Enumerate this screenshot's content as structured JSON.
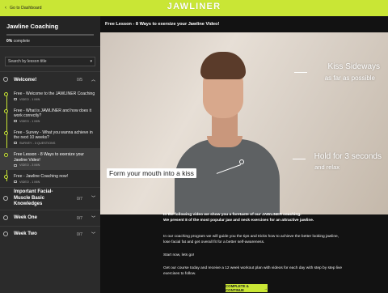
{
  "topbar": {
    "back_label": "Go to Dashboard",
    "logo_text": "JAWLINER"
  },
  "sidebar": {
    "course_title": "Jawline Coaching",
    "progress_percent": 0,
    "progress_value": "0%",
    "progress_text": "complete",
    "search_placeholder": "Search by lesson title",
    "sections": [
      {
        "title": "Welcome!",
        "count": "0/5"
      },
      {
        "title": "Important Facial-Muscle Basic Knowledges",
        "count": "0/7"
      },
      {
        "title": "Week One",
        "count": "0/7"
      },
      {
        "title": "Week Two",
        "count": "0/7"
      }
    ],
    "lessons": [
      {
        "title": "Free - Welcome to the JAWLINER Coaching",
        "meta": "VIDEO - 1 MIN"
      },
      {
        "title": "Free - What is JAWLINER and how does it work correctly?",
        "meta": "VIDEO - 1 MIN"
      },
      {
        "title": "Free - Survey - What you wanna achieve in the next 10 weeks?",
        "meta": "SURVEY - 3 QUESTIONS"
      },
      {
        "title": "Free Lesson - 8 Ways to exersize your Jawline Video!",
        "meta": "VIDEO - 3 MIN"
      },
      {
        "title": "Free - Jawline Coaching now!",
        "meta": "VIDEO - 1 MIN"
      }
    ]
  },
  "content": {
    "lesson_title": "Free Lesson - 8 Ways to exersize your Jawline Video!",
    "video_overlays": {
      "kiss_sideways": "Kiss Sideways",
      "kiss_sideways_sub": "as far as possible",
      "form_mouth": "Form your mouth into a kiss",
      "hold": "Hold for 3 seconds",
      "hold_sub": "and relax"
    },
    "description": {
      "intro1": "In the following video we show you a foretaste of our JAWLINER coaching.",
      "intro2": "We present 8 of the most popular jaw and neck exercises for an attractive jawline.",
      "p1": "In our coaching program we will guide you the tips and tricks how to achieve the better looking jawline, lose facial fat and get overall fit for a better self-awareness.",
      "p2": "Start now, lets go!",
      "p3": "Get our course today and receive a 12 week workout plan with videos for each day with step by step live exercises to follow."
    },
    "cta_label": "COMPLETE & CONTINUE",
    "cta_arrow": "→"
  },
  "colors": {
    "accent": "#c9e635",
    "sidebar_bg": "#2b2b2b",
    "content_bg": "#121212"
  }
}
